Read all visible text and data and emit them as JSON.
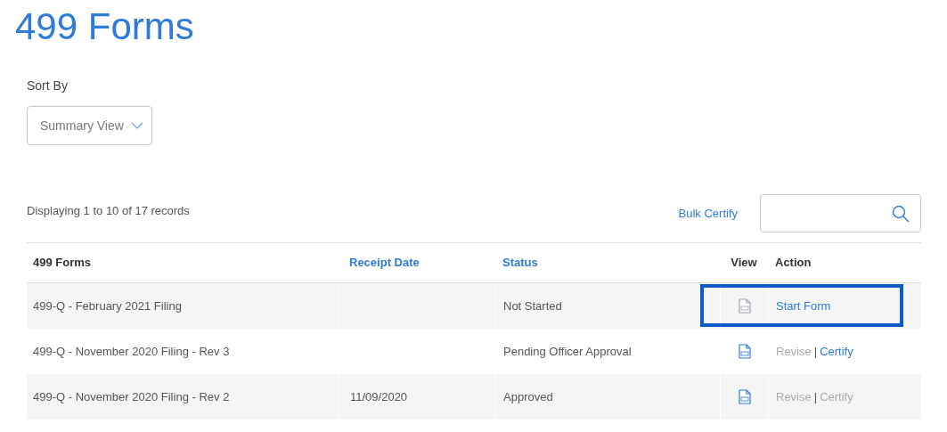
{
  "title": "499 Forms",
  "sort": {
    "label": "Sort By",
    "value": "Summary View"
  },
  "records_info": "Displaying 1 to 10 of 17 records",
  "bulk_certify": "Bulk Certify",
  "table": {
    "columns": [
      {
        "label": "499 Forms",
        "sortable": false
      },
      {
        "label": "Receipt Date",
        "sortable": true
      },
      {
        "label": "Status",
        "sortable": true
      },
      {
        "label": "View",
        "sortable": false
      },
      {
        "label": "Action",
        "sortable": false
      }
    ],
    "rows": [
      {
        "form": "499-Q - February 2021 Filing",
        "status": "Not Started",
        "pdf_available": false,
        "highlighted": true,
        "actions": [
          {
            "label": "Start Form",
            "disabled": false
          }
        ]
      },
      {
        "form": "499-Q - November 2020 Filing - Rev 3",
        "status": "Pending Officer Approval",
        "pdf_available": true,
        "highlighted": false,
        "separator": "|",
        "actions": [
          {
            "label": "Revise",
            "disabled": true
          },
          {
            "label": "Certify",
            "disabled": false
          }
        ]
      },
      {
        "form": "499-Q - November 2020 Filing - Rev 2",
        "receipt_date": "11/09/2020",
        "status": "Approved",
        "pdf_available": true,
        "highlighted": false,
        "separator": "|",
        "actions": [
          {
            "label": "Revise",
            "disabled": true
          },
          {
            "label": "Certify",
            "disabled": true
          }
        ]
      }
    ]
  }
}
